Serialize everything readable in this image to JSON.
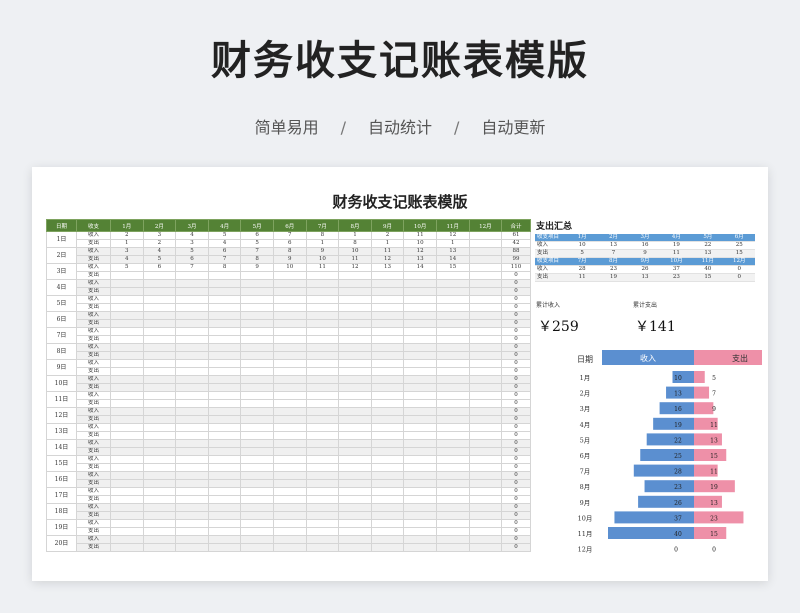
{
  "hero": {
    "title": "财务收支记账表模版",
    "tags": [
      "简单易用",
      "自动统计",
      "自动更新"
    ],
    "separator": "/"
  },
  "sheet": {
    "title": "财务收支记账表模版",
    "headers": [
      "日期",
      "收支",
      "1月",
      "2月",
      "3月",
      "4月",
      "5月",
      "6月",
      "7月",
      "8月",
      "9月",
      "10月",
      "11月",
      "12月",
      "合计"
    ],
    "type_labels": [
      "收入",
      "支出"
    ],
    "days": [
      "1日",
      "2日",
      "3日",
      "4日",
      "5日",
      "6日",
      "7日",
      "8日",
      "9日",
      "10日",
      "11日",
      "12日",
      "13日",
      "14日",
      "15日",
      "16日",
      "17日",
      "18日",
      "19日",
      "20日"
    ],
    "rows_with_data": [
      {
        "values": [
          "2",
          "3",
          "4",
          "5",
          "6",
          "7",
          "8",
          "1",
          "2",
          "11",
          "12",
          "",
          ""
        ],
        "total": "61"
      },
      {
        "values": [
          "1",
          "2",
          "3",
          "4",
          "5",
          "6",
          "1",
          "8",
          "1",
          "10",
          "1",
          "",
          ""
        ],
        "total": "42"
      },
      {
        "values": [
          "3",
          "4",
          "5",
          "6",
          "7",
          "8",
          "9",
          "10",
          "11",
          "12",
          "13",
          "",
          ""
        ],
        "total": "88"
      },
      {
        "values": [
          "4",
          "5",
          "6",
          "7",
          "8",
          "9",
          "10",
          "11",
          "12",
          "13",
          "14",
          "",
          ""
        ],
        "total": "99"
      },
      {
        "values": [
          "5",
          "6",
          "7",
          "8",
          "9",
          "10",
          "11",
          "12",
          "13",
          "14",
          "15",
          "",
          ""
        ],
        "total": "110"
      }
    ],
    "empty_total": "0"
  },
  "summary": {
    "label": "支出汇总",
    "header1": [
      "收支项目",
      "1月",
      "2月",
      "3月",
      "4月",
      "5月",
      "6月"
    ],
    "income1": [
      "收入",
      "10",
      "13",
      "16",
      "19",
      "22",
      "25"
    ],
    "expense1": [
      "支出",
      "5",
      "7",
      "9",
      "11",
      "13",
      "15"
    ],
    "header2": [
      "收支项目",
      "7月",
      "8月",
      "9月",
      "10月",
      "11月",
      "12月"
    ],
    "income2": [
      "收入",
      "28",
      "23",
      "26",
      "37",
      "40",
      "0"
    ],
    "expense2": [
      "支出",
      "11",
      "19",
      "13",
      "23",
      "15",
      "0"
    ]
  },
  "totals": {
    "income_label": "累计收入",
    "income_value": "￥259",
    "expense_label": "累计支出",
    "expense_value": "￥141"
  },
  "chart_data": {
    "type": "bar",
    "orientation": "horizontal-diverging",
    "header": {
      "category": "日期",
      "left": "收入",
      "right": "支出"
    },
    "categories": [
      "1月",
      "2月",
      "3月",
      "4月",
      "5月",
      "6月",
      "7月",
      "8月",
      "9月",
      "10月",
      "11月",
      "12月"
    ],
    "series": [
      {
        "name": "收入",
        "values": [
          10,
          13,
          16,
          19,
          22,
          25,
          28,
          23,
          26,
          37,
          40,
          0
        ],
        "color": "#5b8fd0"
      },
      {
        "name": "支出",
        "values": [
          5,
          7,
          9,
          11,
          13,
          15,
          11,
          19,
          13,
          23,
          15,
          0
        ],
        "color": "#ee90a8"
      }
    ],
    "xlim": [
      0,
      40
    ]
  },
  "colors": {
    "header_green": "#548235",
    "summary_blue": "#5b9bd5",
    "income_bar": "#5b8fd0",
    "expense_bar": "#ee90a8"
  }
}
